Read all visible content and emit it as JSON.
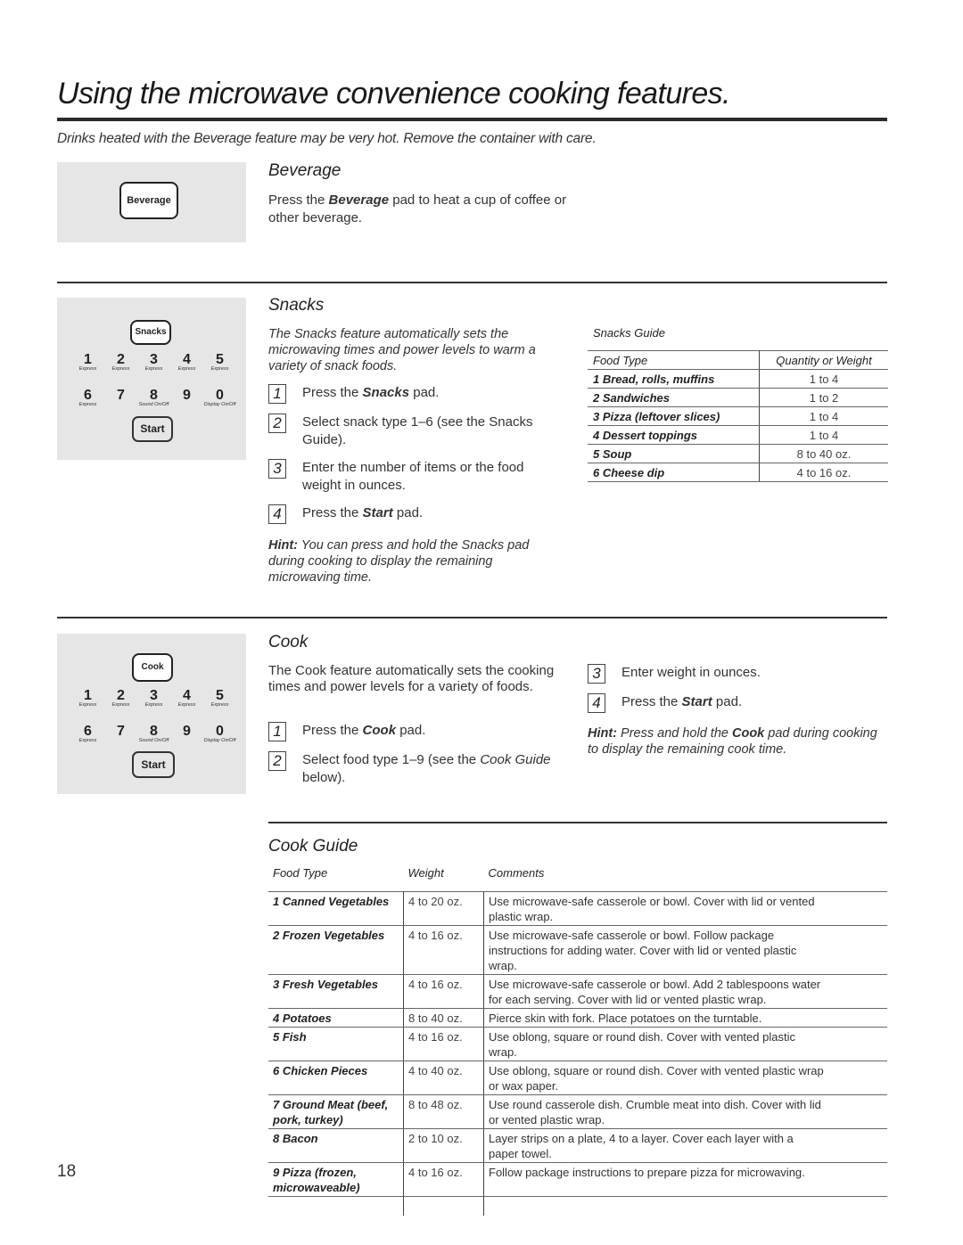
{
  "page": {
    "title": "Using the microwave convenience cooking features.",
    "note": "Drinks heated with the Beverage feature may be very hot. Remove the container with care.",
    "page_number": "18"
  },
  "beverage": {
    "heading": "Beverage",
    "pad_label": "Beverage",
    "text_pre": "Press the ",
    "text_bold": "Beverage",
    "text_post": " pad to heat a cup of coffee or other beverage."
  },
  "keypad": {
    "row1": [
      {
        "digit": "1",
        "sub": "Express"
      },
      {
        "digit": "2",
        "sub": "Express"
      },
      {
        "digit": "3",
        "sub": "Express"
      },
      {
        "digit": "4",
        "sub": "Express"
      },
      {
        "digit": "5",
        "sub": "Express"
      }
    ],
    "row2": [
      {
        "digit": "6",
        "sub": "Express"
      },
      {
        "digit": "7",
        "sub": ""
      },
      {
        "digit": "8",
        "sub": "Sound On/Off"
      },
      {
        "digit": "9",
        "sub": ""
      },
      {
        "digit": "0",
        "sub": "Display On/Off"
      }
    ],
    "start_label": "Start"
  },
  "snacks": {
    "heading": "Snacks",
    "pad_label": "Snacks",
    "intro": "The Snacks feature automatically sets the microwaving times and power levels to warm a variety of snack foods.",
    "steps": [
      {
        "num": "1",
        "pre": "Press the ",
        "bold": "Snacks",
        "post": " pad."
      },
      {
        "num": "2",
        "pre": "Select snack type 1–6 (see the Snacks Guide).",
        "bold": "",
        "post": ""
      },
      {
        "num": "3",
        "pre": "Enter the number of items or the food weight in ounces.",
        "bold": "",
        "post": ""
      },
      {
        "num": "4",
        "pre": "Press the ",
        "bold": "Start",
        "post": " pad."
      }
    ],
    "hint_label": "Hint:",
    "hint_text": " You can press and hold the Snacks pad during cooking to display the remaining microwaving time.",
    "guide": {
      "title": "Snacks Guide",
      "headers": [
        "Food Type",
        "Quantity or Weight"
      ],
      "rows": [
        [
          "1 Bread, rolls, muffins",
          "1 to 4"
        ],
        [
          "2 Sandwiches",
          "1 to 2"
        ],
        [
          "3 Pizza (leftover slices)",
          "1 to 4"
        ],
        [
          "4 Dessert toppings",
          "1 to 4"
        ],
        [
          "5 Soup",
          "8 to 40 oz."
        ],
        [
          "6 Cheese dip",
          "4 to 16 oz."
        ]
      ]
    }
  },
  "cook": {
    "heading": "Cook",
    "pad_label": "Cook",
    "intro": "The Cook feature automatically sets the cooking times and power levels for a variety of foods.",
    "steps": [
      {
        "num": "1",
        "pre": "Press the ",
        "bold": "Cook",
        "post": " pad.",
        "ital": ""
      },
      {
        "num": "2",
        "pre": "Select food type 1–9 (see the ",
        "bold": "",
        "post": " below).",
        "ital": "Cook Guide"
      },
      {
        "num": "3",
        "pre": "Enter weight in ounces.",
        "bold": "",
        "post": "",
        "ital": ""
      },
      {
        "num": "4",
        "pre": "Press the ",
        "bold": "Start",
        "post": " pad.",
        "ital": ""
      }
    ],
    "hint_label": "Hint:",
    "hint_pre": " Press and hold the ",
    "hint_bold": "Cook",
    "hint_post": " pad during cooking to display the remaining cook time."
  },
  "cook_guide": {
    "title": "Cook Guide",
    "headers": [
      "Food Type",
      "Weight",
      "Comments"
    ],
    "rows": [
      [
        "1 Canned Vegetables",
        "4 to 20 oz.",
        "Use microwave-safe casserole or bowl. Cover with lid or vented plastic wrap."
      ],
      [
        "2 Frozen Vegetables",
        "4 to 16 oz.",
        "Use microwave-safe casserole or bowl. Follow package instructions for adding water. Cover with lid or vented plastic wrap."
      ],
      [
        "3 Fresh Vegetables",
        "4 to 16 oz.",
        "Use microwave-safe casserole or bowl. Add 2 tablespoons water for each serving. Cover with lid or vented plastic wrap."
      ],
      [
        "4 Potatoes",
        "8 to 40 oz.",
        "Pierce skin with fork. Place potatoes on the turntable."
      ],
      [
        "5 Fish",
        "4 to 16 oz.",
        "Use oblong, square or round dish. Cover with vented plastic wrap."
      ],
      [
        "6 Chicken Pieces",
        "4 to 40 oz.",
        "Use oblong, square or round dish. Cover with vented plastic wrap or wax paper."
      ],
      [
        "7 Ground Meat (beef, pork, turkey)",
        "8 to 48 oz.",
        "Use round casserole dish. Crumble meat into dish. Cover with lid or vented plastic wrap."
      ],
      [
        "8 Bacon",
        "2 to 10 oz.",
        "Layer strips on a plate, 4 to a layer. Cover each layer with a paper towel."
      ],
      [
        "9 Pizza (frozen, microwaveable)",
        "4 to 16 oz.",
        "Follow package instructions to prepare pizza for microwaving."
      ]
    ]
  }
}
